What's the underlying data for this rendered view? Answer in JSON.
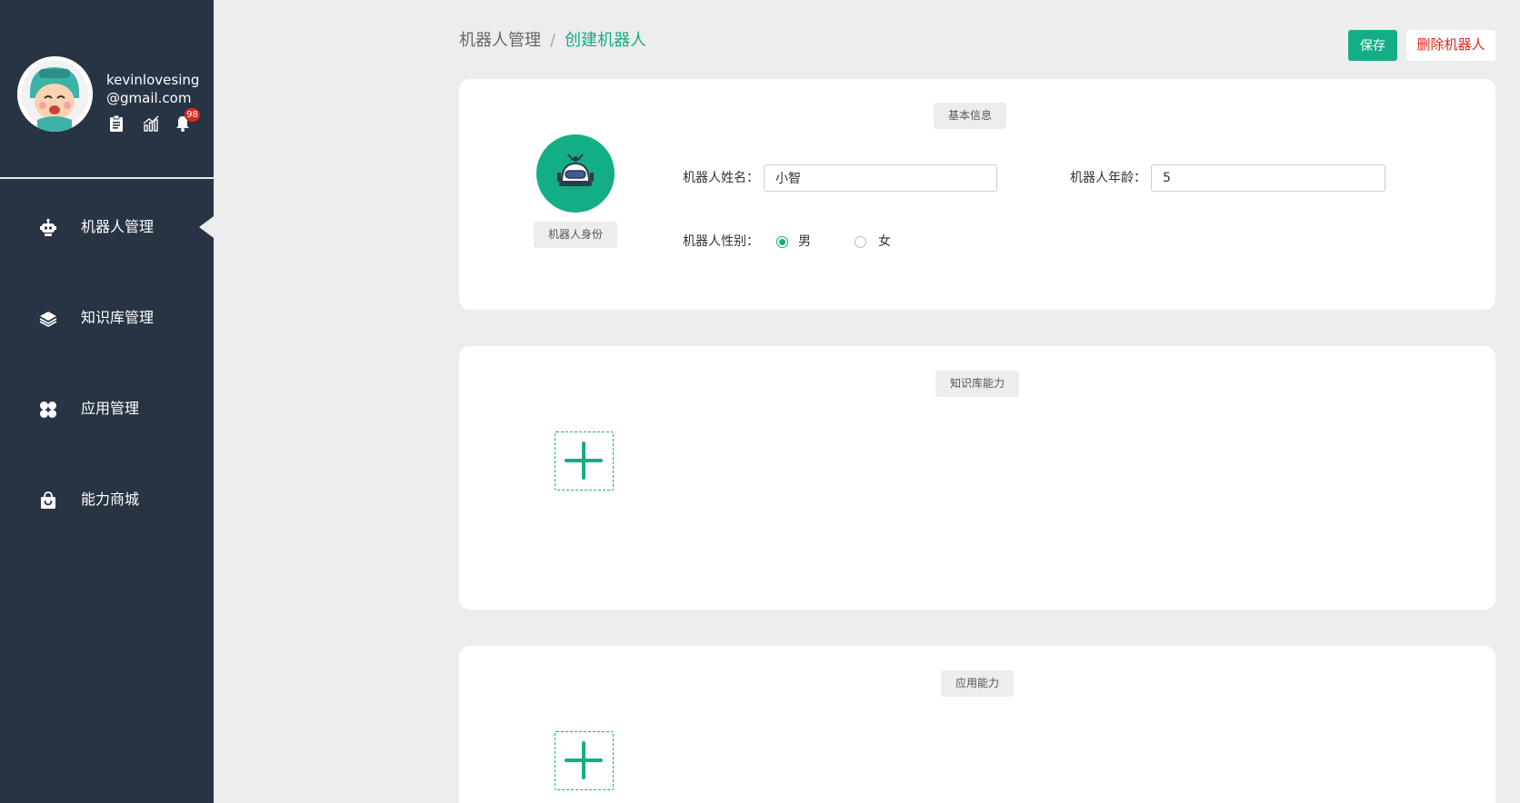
{
  "user": {
    "email": "kevinlovesing@gmail.com",
    "notification_count": "98"
  },
  "nav": {
    "items": [
      {
        "label": "机器人管理",
        "icon": "robot-icon",
        "active": true
      },
      {
        "label": "知识库管理",
        "icon": "layers-icon",
        "active": false
      },
      {
        "label": "应用管理",
        "icon": "apps-icon",
        "active": false
      },
      {
        "label": "能力商城",
        "icon": "shop-bag-icon",
        "active": false
      }
    ]
  },
  "breadcrumb": {
    "parent": "机器人管理",
    "separator": "/",
    "current": "创建机器人"
  },
  "toolbar": {
    "save_label": "保存",
    "delete_label": "删除机器人"
  },
  "basic_info": {
    "section_label": "基本信息",
    "identity_button": "机器人身份",
    "name_label": "机器人姓名：",
    "name_value": "小智",
    "age_label": "机器人年龄：",
    "age_value": "5",
    "gender_label": "机器人性别：",
    "gender_options": [
      "男",
      "女"
    ],
    "gender_selected": "男"
  },
  "knowledge": {
    "section_label": "知识库能力"
  },
  "apps": {
    "section_label": "应用能力"
  },
  "colors": {
    "accent": "#13ae85",
    "sidebar": "#283443",
    "danger": "#e0261e",
    "background": "#ededed"
  }
}
